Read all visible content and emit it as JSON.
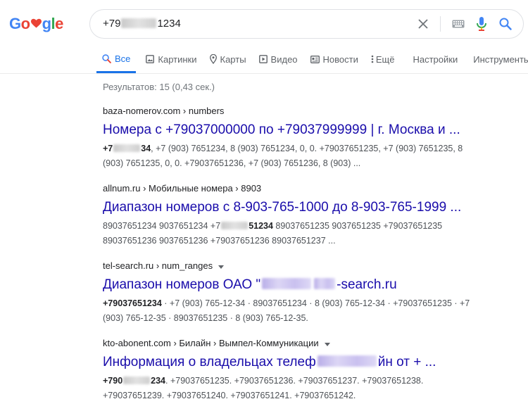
{
  "logo": {
    "letters": [
      "G",
      "o",
      "",
      "g",
      "l",
      "e"
    ]
  },
  "colors": {
    "blue": "#4285F4",
    "red": "#EA4335",
    "yellow": "#FBBC05",
    "green": "#34A853",
    "accent": "#1a73e8",
    "link": "#1a0dab"
  },
  "search": {
    "query_prefix": "+79",
    "query_suffix": "1234"
  },
  "tabs": [
    {
      "label": "Все",
      "icon": "search-icon"
    },
    {
      "label": "Картинки",
      "icon": "image-icon"
    },
    {
      "label": "Карты",
      "icon": "map-pin-icon"
    },
    {
      "label": "Видео",
      "icon": "video-icon"
    },
    {
      "label": "Новости",
      "icon": "news-icon"
    },
    {
      "label": "Ещё",
      "icon": "more-vert-icon"
    },
    {
      "label": "Настройки"
    },
    {
      "label": "Инструменты"
    }
  ],
  "stats": "Результатов: 15 (0,43 сек.)",
  "results": [
    {
      "crumb": "baza-nomerov.com › numbers",
      "title": "Номера с +79037000000 по +79037999999 | г. Москва и ...",
      "snippet_bold_a": "+7",
      "snippet_bold_b": "34",
      "snippet_line1": ", +7 (903) 7651234, 8 (903) 7651234, 0, 0. +79037651235, +7 (903) 7651235, 8",
      "snippet_line2": "(903) 7651235, 0, 0. +79037651236, +7 (903) 7651236, 8 (903) ..."
    },
    {
      "crumb": "allnum.ru › Мобильные номера › 8903",
      "title": "Диапазон номеров с 8-903-765-1000 до 8-903-765-1999 ...",
      "snippet_pre": "89037651234 9037651234 +7",
      "snippet_bold_b": "51234",
      "snippet_line1_post": " 89037651235 9037651235 +79037651235",
      "snippet_line2": "89037651236 9037651236 +79037651236 89037651237 ..."
    },
    {
      "crumb": "tel-search.ru › num_ranges",
      "title_pre": "Диапазон номеров ОАО \"",
      "title_post": "-search.ru",
      "snippet_bold": "+79037651234",
      "snippet_line1_post": " · +7 (903) 765-12-34 · 89037651234 · 8 (903) 765-12-34 · +79037651235 · +7",
      "snippet_line2": "(903) 765-12-35 · 89037651235 · 8 (903) 765-12-35."
    },
    {
      "crumb": "kto-abonent.com › Билайн › Вымпел-Коммуникации",
      "title_pre": "Информация о владельцах телеф",
      "title_post": "йн от + ...",
      "snippet_bold_a": "+790",
      "snippet_bold_b": "234",
      "snippet_line1": ". +79037651235. +79037651236. +79037651237. +79037651238.",
      "snippet_line2": "+79037651239. +79037651240. +79037651241. +79037651242."
    }
  ]
}
